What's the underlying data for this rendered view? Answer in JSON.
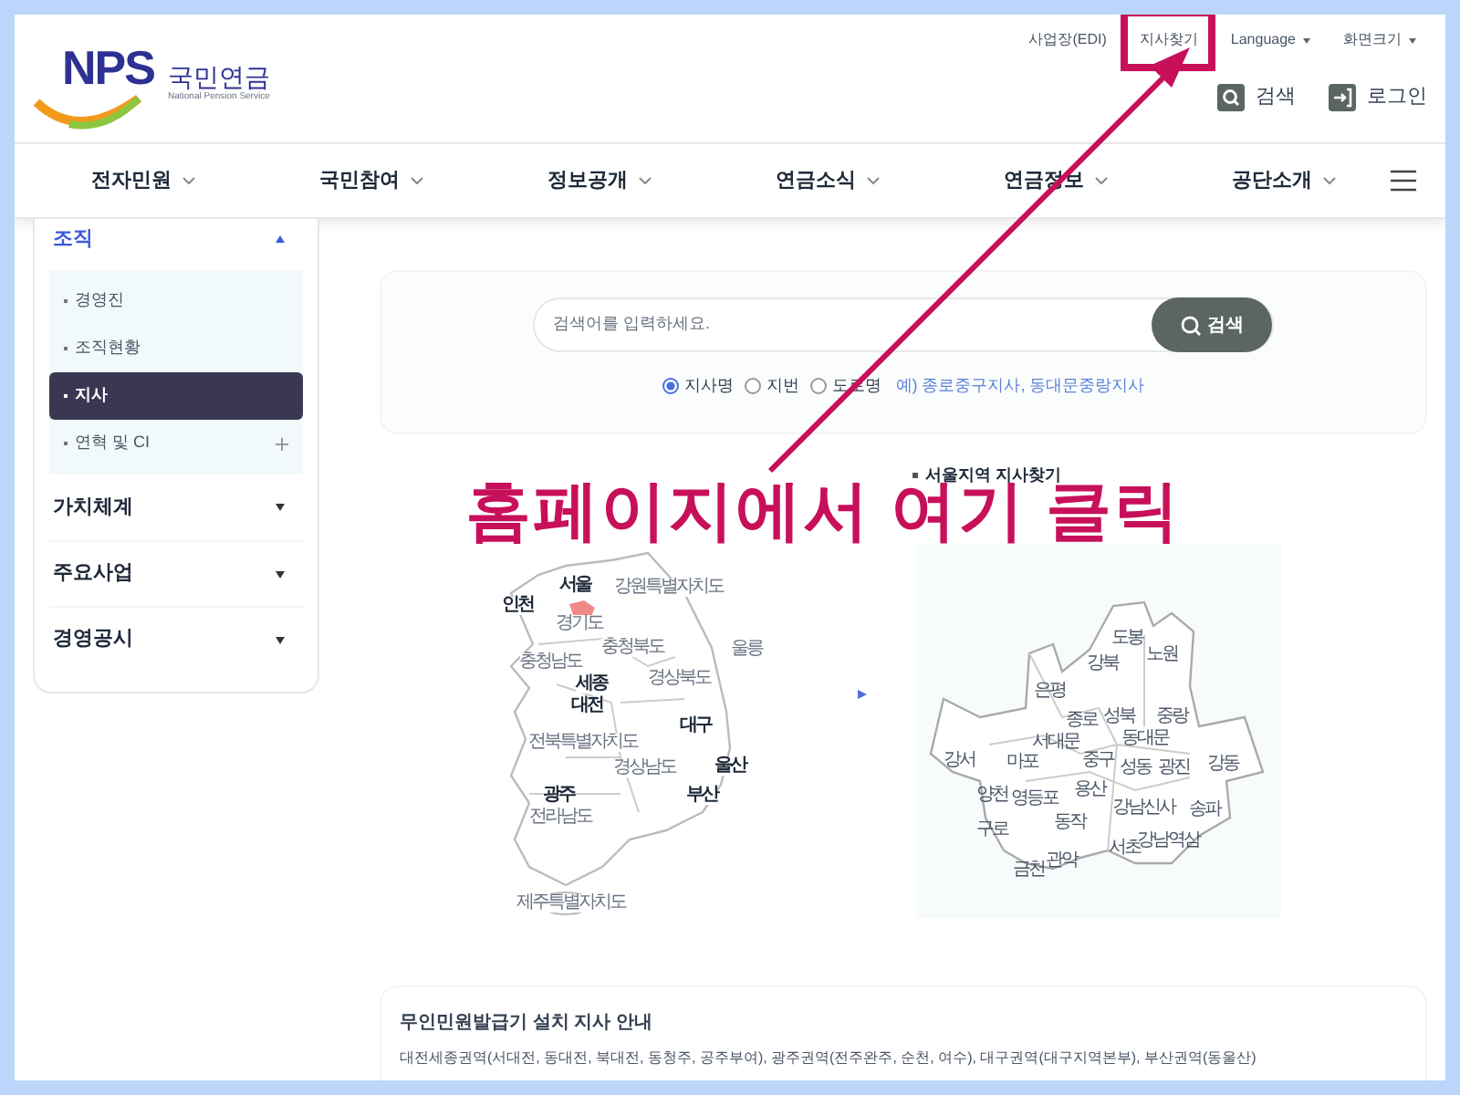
{
  "logo": {
    "mark": "NPS",
    "name": "국민연금",
    "subtitle": "National Pension Service"
  },
  "top_links": [
    {
      "label": "사업장(EDI)",
      "dropdown": false
    },
    {
      "label": "지사찾기",
      "dropdown": false
    },
    {
      "label": "Language",
      "dropdown": true
    },
    {
      "label": "화면크기",
      "dropdown": true
    }
  ],
  "header_buttons": [
    {
      "label": "검색",
      "kind": "search"
    },
    {
      "label": "로그인",
      "kind": "login"
    }
  ],
  "nav": [
    "전자민원",
    "국민참여",
    "정보공개",
    "연금소식",
    "연금정보",
    "공단소개"
  ],
  "sidebar": {
    "title": "조직",
    "expanded": true,
    "items": [
      {
        "label": "경영진",
        "selected": false,
        "expandable": false
      },
      {
        "label": "조직현황",
        "selected": false,
        "expandable": false
      },
      {
        "label": "지사",
        "selected": true,
        "expandable": false
      },
      {
        "label": "연혁 및 CI",
        "selected": false,
        "expandable": true
      }
    ],
    "sections": [
      "가치체계",
      "주요사업",
      "경영공시"
    ]
  },
  "search": {
    "placeholder": "검색어를 입력하세요.",
    "button": "검색",
    "options": [
      {
        "label": "지사명",
        "selected": true
      },
      {
        "label": "지번",
        "selected": false
      },
      {
        "label": "도로명",
        "selected": false
      }
    ],
    "example": "예) 종로중구지사, 동대문중랑지사"
  },
  "korea_map": {
    "labels": [
      {
        "text": "서울",
        "kind": "city"
      },
      {
        "text": "인천",
        "kind": "city"
      },
      {
        "text": "강원특별자치도",
        "kind": "province"
      },
      {
        "text": "경기도",
        "kind": "province"
      },
      {
        "text": "충청북도",
        "kind": "province"
      },
      {
        "text": "충청남도",
        "kind": "province"
      },
      {
        "text": "세종",
        "kind": "city"
      },
      {
        "text": "대전",
        "kind": "city"
      },
      {
        "text": "경상북도",
        "kind": "province"
      },
      {
        "text": "대구",
        "kind": "city"
      },
      {
        "text": "전북특별자치도",
        "kind": "province"
      },
      {
        "text": "울산",
        "kind": "city"
      },
      {
        "text": "경상남도",
        "kind": "province"
      },
      {
        "text": "부산",
        "kind": "city"
      },
      {
        "text": "광주",
        "kind": "city"
      },
      {
        "text": "전라남도",
        "kind": "province"
      },
      {
        "text": "제주특별자치도",
        "kind": "province"
      },
      {
        "text": "울릉",
        "kind": "province"
      }
    ]
  },
  "seoul": {
    "title": "서울지역 지사찾기",
    "districts": [
      "도봉",
      "노원",
      "강북",
      "은평",
      "종로",
      "성북",
      "중랑",
      "서대문",
      "동대문",
      "강서",
      "마포",
      "중구",
      "성동",
      "광진",
      "강동",
      "양천",
      "영등포",
      "용산",
      "강남신사",
      "송파",
      "구로",
      "동작",
      "서초",
      "강남역삼",
      "금천",
      "관악"
    ]
  },
  "kiosk": {
    "title": "무인민원발급기 설치 지사 안내",
    "text": "대전세종권역(서대전, 동대전, 북대전, 동청주, 공주부여), 광주권역(전주완주, 순천, 여수), 대구권역(대구지역본부), 부산권역(동울산)"
  },
  "annotation": {
    "text": "홈페이지에서 여기 클릭"
  }
}
